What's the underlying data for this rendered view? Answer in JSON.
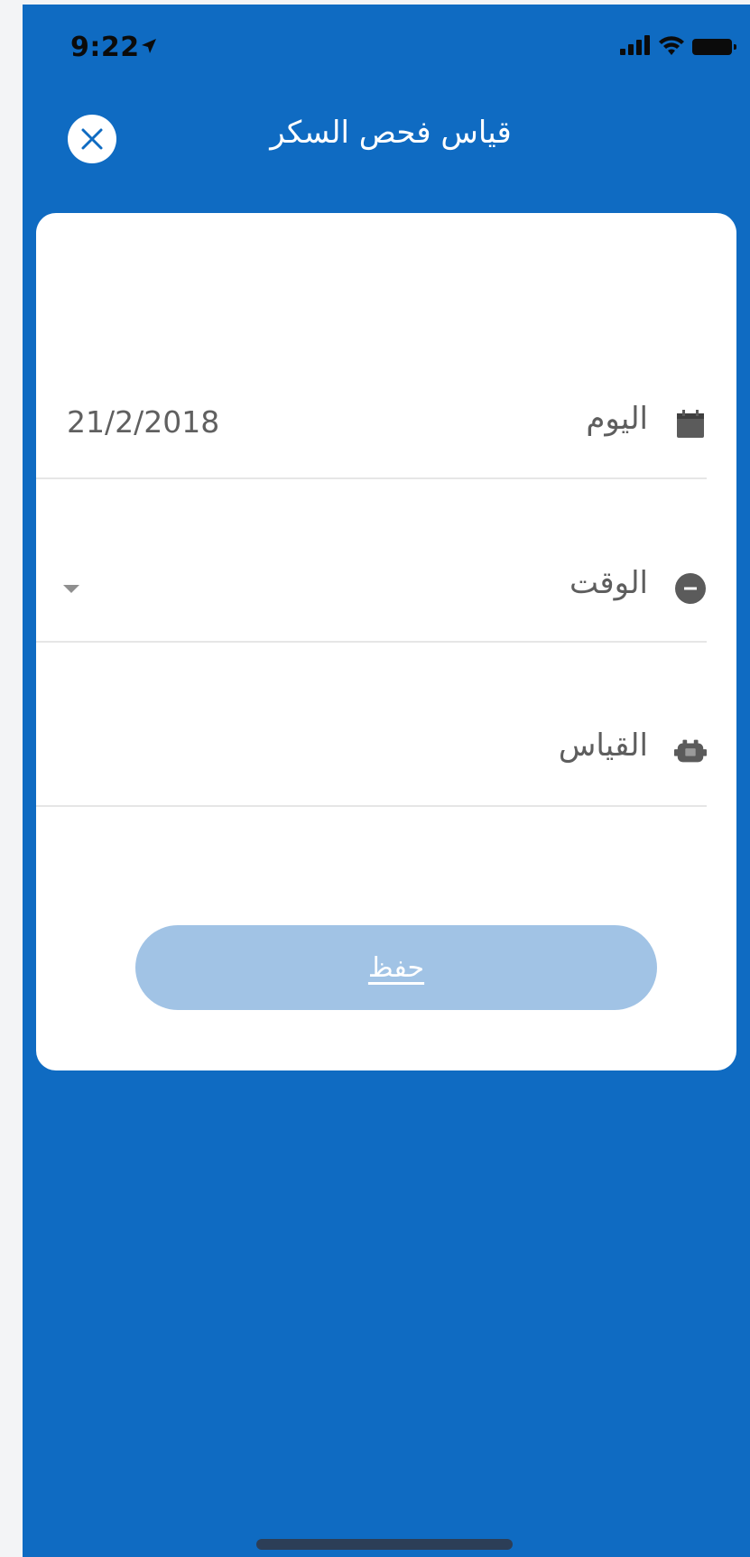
{
  "status_bar": {
    "time": "9:22",
    "location_icon": "location-arrow-icon",
    "signal_icon": "cellular-signal-icon",
    "wifi_icon": "wifi-icon",
    "battery_icon": "battery-icon"
  },
  "header": {
    "title": "قياس فحص السكر",
    "close_icon": "close-icon"
  },
  "form": {
    "day": {
      "label": "اليوم",
      "value": "21/2/2018",
      "icon": "calendar-icon"
    },
    "time": {
      "label": "الوقت",
      "value": "",
      "icon": "clock-icon"
    },
    "measurement": {
      "label": "القياس",
      "value": "",
      "icon": "glucose-meter-icon"
    }
  },
  "actions": {
    "save_label": "حفظ"
  },
  "colors": {
    "primary": "#0f6bc2",
    "button_disabled": "#a1c3e5",
    "card": "#ffffff",
    "label": "#5e5e5e"
  }
}
